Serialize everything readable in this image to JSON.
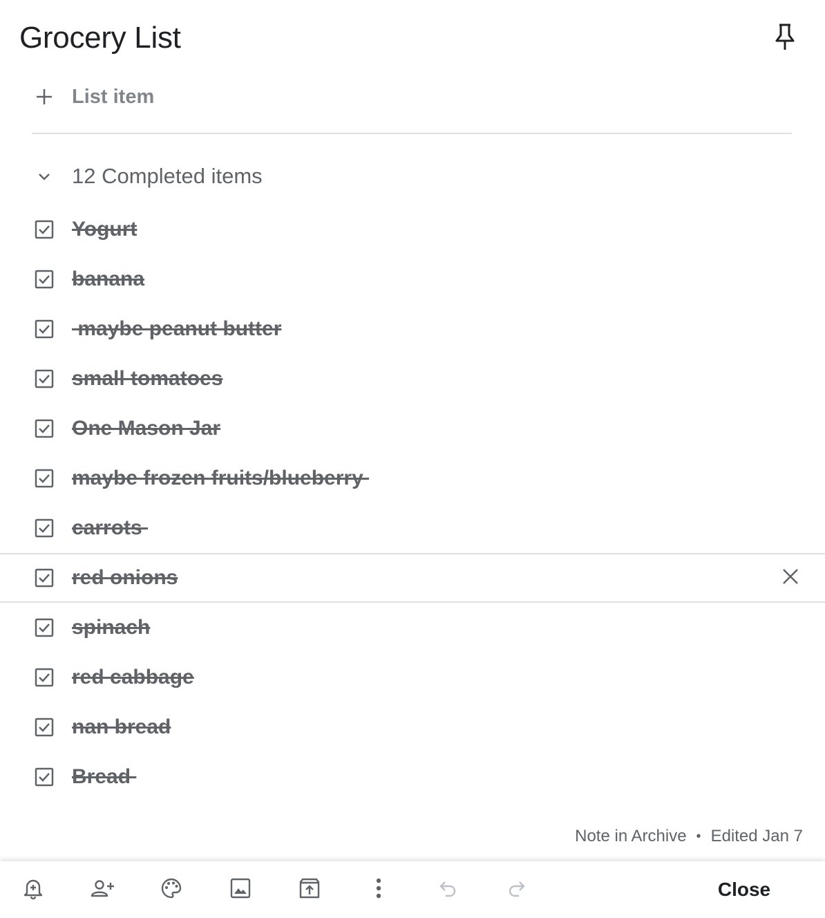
{
  "note": {
    "title": "Grocery List"
  },
  "add_item": {
    "label": "List item"
  },
  "completed": {
    "header": "12 Completed items",
    "items": [
      {
        "text": "Yogurt",
        "checked": true
      },
      {
        "text": "banana",
        "checked": true
      },
      {
        "text": " maybe peanut butter",
        "checked": true
      },
      {
        "text": "small tomatoes",
        "checked": true
      },
      {
        "text": "One Mason Jar",
        "checked": true
      },
      {
        "text": "maybe frozen fruits/blueberry ",
        "checked": true
      },
      {
        "text": "carrots ",
        "checked": true
      },
      {
        "text": "red onions",
        "checked": true
      },
      {
        "text": "spinach",
        "checked": true
      },
      {
        "text": "red cabbage",
        "checked": true
      },
      {
        "text": "nan bread",
        "checked": true
      },
      {
        "text": "Bread ",
        "checked": true
      }
    ]
  },
  "footer": {
    "location": "Note in Archive",
    "separator": "•",
    "edited": "Edited Jan 7"
  },
  "toolbar": {
    "icons": [
      "remind-me-icon",
      "collaborator-icon",
      "palette-icon",
      "image-icon",
      "unarchive-icon",
      "more-vert-icon",
      "undo-icon",
      "redo-icon"
    ],
    "close_label": "Close"
  },
  "colors": {
    "text_primary": "#202124",
    "text_secondary": "#5f6368",
    "icon": "#5f6368",
    "disabled_icon": "#bdc1c6",
    "divider": "#e0e0e0"
  }
}
